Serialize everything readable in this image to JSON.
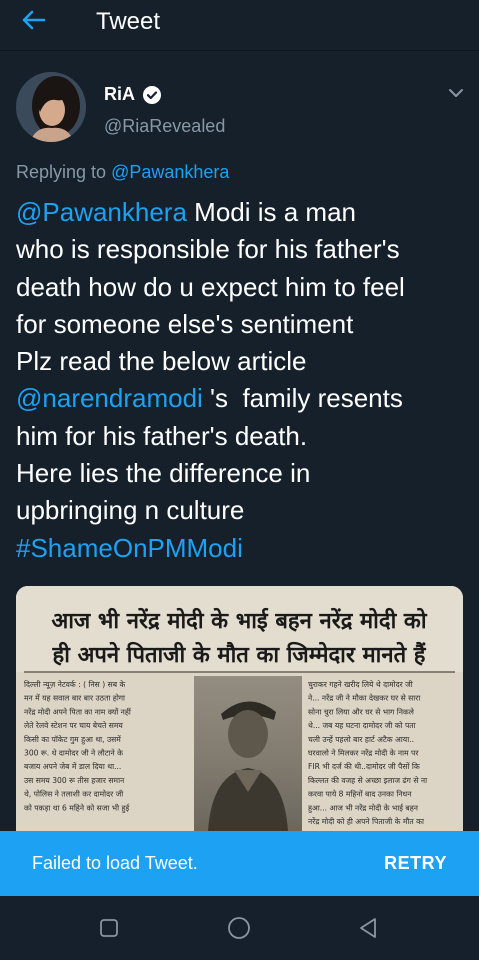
{
  "header": {
    "title": "Tweet",
    "back_icon": "arrow-left-icon"
  },
  "tweet": {
    "display_name": "RiA",
    "handle": "@RiaRevealed",
    "replying_prefix": "Replying to",
    "replying_to": "@Pawankhera",
    "lines": [
      {
        "segments": [
          {
            "text": "@Pawankhera",
            "link": true
          },
          {
            "text": " Modi is a man",
            "link": false
          }
        ]
      },
      {
        "segments": [
          {
            "text": "who is responsible for his father's",
            "link": false
          }
        ]
      },
      {
        "segments": [
          {
            "text": "death how do u expect him to feel",
            "link": false
          }
        ]
      },
      {
        "segments": [
          {
            "text": "for someone else's sentiment",
            "link": false
          }
        ]
      },
      {
        "segments": [
          {
            "text": "Plz read the below article",
            "link": false
          }
        ]
      },
      {
        "segments": [
          {
            "text": "@narendramodi",
            "link": true
          },
          {
            "text": " 's  family resents",
            "link": false
          }
        ]
      },
      {
        "segments": [
          {
            "text": "him for his father's death.",
            "link": false
          }
        ]
      },
      {
        "segments": [
          {
            "text": "Here lies the difference in",
            "link": false
          }
        ]
      },
      {
        "segments": [
          {
            "text": "upbringing n culture",
            "link": false
          }
        ]
      },
      {
        "segments": [
          {
            "text": "#ShameOnPMModi",
            "link": true
          }
        ]
      }
    ],
    "image": {
      "headline_1": "आज भी नरेंद्र मोदी के भाई बहन नरेंद्र मोदी को",
      "headline_2": "ही अपने पिताजी के मौत का जिम्मेदार मानते हैं",
      "col_left": [
        "दिल्ली न्यूज़ नेटवर्क : ( निस ) सब के",
        "मन में यह सवाल बार बार उठता होगा",
        "नरेंद्र मोदी अपने पिता का नाम क्यों नहीं",
        "लेते रेलवे स्टेशन पर चाय बेचते समय",
        "किसी का पॉकेट गुम हुआ था, उसमें",
        "300 रू. थे दामोदर जी ने लौटाने के",
        "बजाय अपने जेब में डाल दिया था...",
        "उस समय 300 रू तीस हजार समान",
        "थे, पोलिस ने तलाशी कर दामोदर जी",
        "को पकड़ा था 6 महिने को सजा भी हुई"
      ],
      "col_right": [
        "चुराकर गहने खरीद लिये थे दामोदर जी",
        "ने... नरेंद्र जी ने मौका देखकर घर से सारा",
        "सोना चुरा लिया और घर से भाग निकले",
        "थे... जब यह घटना दामोदर जी को पता",
        "चली उन्हें पहलो बार हार्ट अटैक आया..",
        "घरवालो ने मिलकर नरेंद्र मोदी के नाम पर",
        "FIR भी दर्ज की थी..दामोदर जी पैसों कि",
        "किल्लत की वजह से अच्छा इलाज ढंग से ना",
        "करवा पाये 8 महिनों बाद उनका निधन",
        "हुआ... आज भी नरेंद्र मोदी के भाई बहन",
        "नरेंद्र मोदी को ही अपने पिताजी के मौत का"
      ]
    }
  },
  "banner": {
    "message": "Failed to load Tweet.",
    "action": "RETRY"
  },
  "nav": {
    "icons": [
      "recent-apps-icon",
      "home-icon",
      "back-triangle-icon"
    ]
  },
  "colors": {
    "accent": "#1da1f2",
    "background": "#15202b",
    "secondary_text": "#8899a6"
  }
}
